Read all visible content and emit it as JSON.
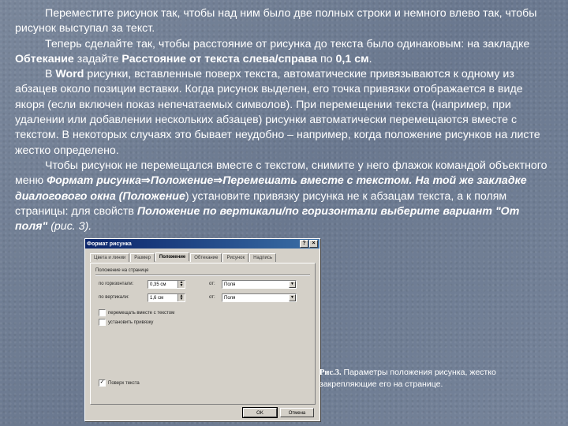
{
  "paragraphs": {
    "p1": "Переместите рисунок так, чтобы над ним было две полных строки и немного влево так, чтобы рисунок выступал за текст.",
    "p2_a": "Теперь сделайте так, чтобы расстояние от рисунка до текста было одинаковым: на закладке ",
    "p2_b": "Обтекание",
    "p2_c": " задайте ",
    "p2_d": "Расстояние от текста слева/справа",
    "p2_e": " по ",
    "p2_f": "0,1 см",
    "p2_g": ".",
    "p3_a": "В ",
    "p3_b": "Word",
    "p3_c": " рисунки, вставленные поверх текста, автоматические привязываются к одному из абзацев около позиции вставки. Когда рисунок выделен, его точка привязки отображается в виде якоря (если включен показ непечатаемых символов). При перемещении текста (например, при удалении или добавлении нескольких абзацев) рисунки автоматически перемещаются вместе с текстом. В некоторых случаях это бывает неудобно – например, когда положение рисунков на листе жестко определено.",
    "p4_a": "Чтобы рисунок не перемещался вместе с текстом, снимите у него флажок командой объектного меню ",
    "p4_b": "Формат рисунка",
    "p4_arrow1": "⇒",
    "p4_c": "Положение",
    "p4_arrow2": "⇒",
    "p4_d": "Перемешать вместе с текстом. На той же закладке диалогового окна (Положение",
    "p4_e": ") установите привязку рисунка не к абзацам текста, а к полям страницы: для свойств ",
    "p4_f": "Положение по вертикали/по горизонтали выберите вариант \"От поля\"",
    "p4_g": " (рис. 3)."
  },
  "dialog": {
    "title": "Формат рисунка",
    "help_btn": "?",
    "close_btn": "×",
    "tabs": [
      "Цвета и линии",
      "Размер",
      "Положение",
      "Обтекание",
      "Рисунок",
      "Надпись"
    ],
    "group_label": "Положение на странице",
    "horiz_label": "по горизонтали:",
    "horiz_value": "0,35 см",
    "horiz_from_label": "от:",
    "horiz_from_value": "Поля",
    "vert_label": "по вертикали:",
    "vert_value": "1,6 см",
    "vert_from_label": "от:",
    "vert_from_value": "Поля",
    "check1_label": "перемещать вместе с текстом",
    "check2_label": "установить привязку",
    "check3_label": "Поверх текста",
    "check3_mark": "✓",
    "ok_label": "OK",
    "cancel_label": "Отмена"
  },
  "caption": {
    "num": "Рис.3.",
    "text": " Параметры положения рисунка, жестко закрепляющие его на странице."
  }
}
